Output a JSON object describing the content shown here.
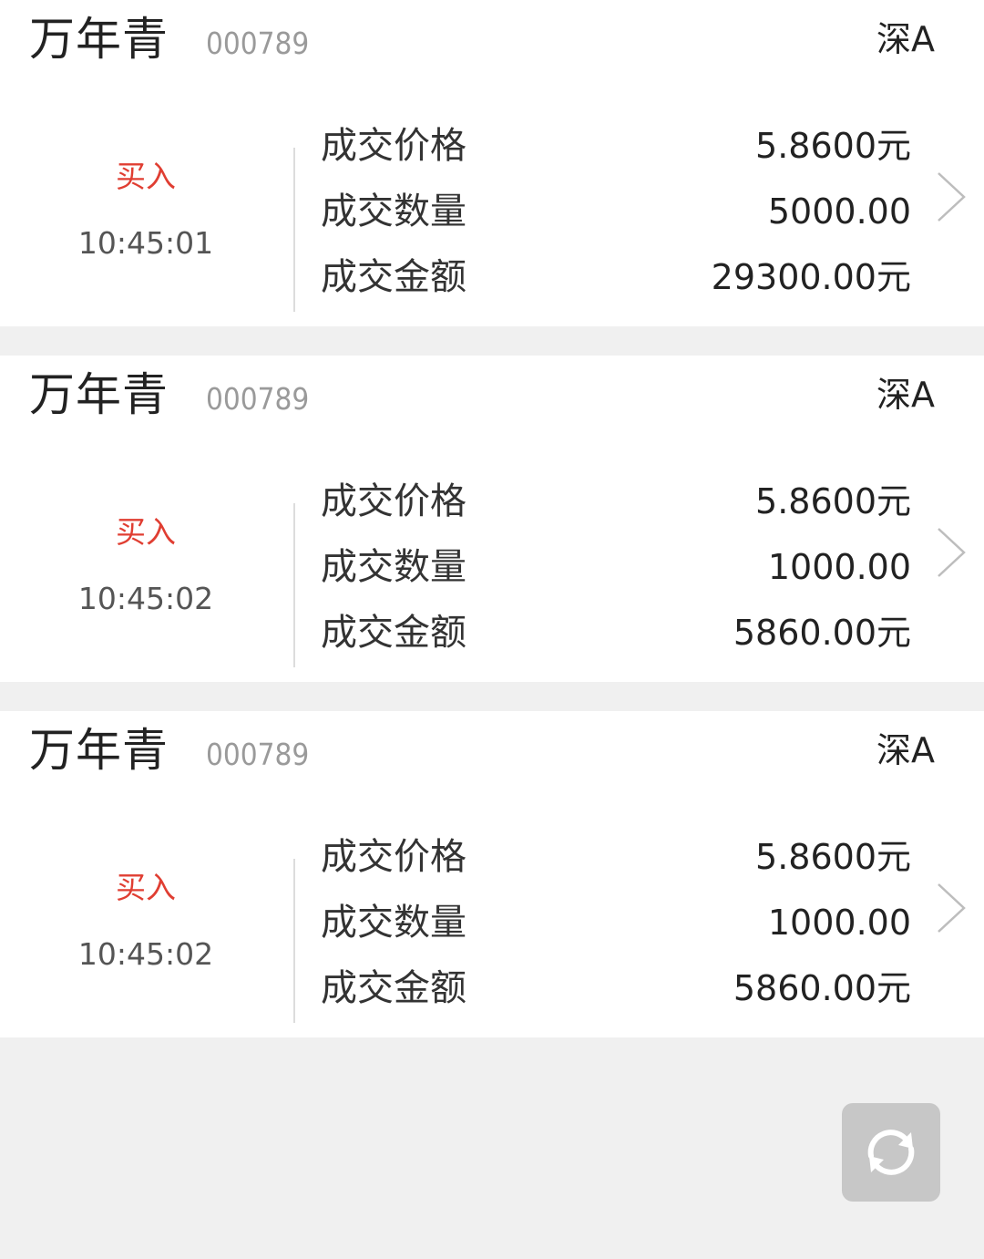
{
  "trades": [
    {
      "stock_name": "万年青",
      "stock_code": "000789",
      "market": "深A",
      "side": "买入",
      "time": "10:45:01",
      "price_label": "成交价格",
      "price_value": "5.8600元",
      "qty_label": "成交数量",
      "qty_value": "5000.00",
      "amount_label": "成交金额",
      "amount_value": "29300.00元"
    },
    {
      "stock_name": "万年青",
      "stock_code": "000789",
      "market": "深A",
      "side": "买入",
      "time": "10:45:02",
      "price_label": "成交价格",
      "price_value": "5.8600元",
      "qty_label": "成交数量",
      "qty_value": "1000.00",
      "amount_label": "成交金额",
      "amount_value": "5860.00元"
    },
    {
      "stock_name": "万年青",
      "stock_code": "000789",
      "market": "深A",
      "side": "买入",
      "time": "10:45:02",
      "price_label": "成交价格",
      "price_value": "5.8600元",
      "qty_label": "成交数量",
      "qty_value": "1000.00",
      "amount_label": "成交金额",
      "amount_value": "5860.00元"
    }
  ],
  "colors": {
    "buy": "#e03e32",
    "background": "#f0f0f0",
    "card": "#ffffff",
    "refresh_button": "#c7c7c7"
  },
  "icons": {
    "row_chevron": "chevron-right-icon",
    "refresh": "refresh-icon"
  }
}
